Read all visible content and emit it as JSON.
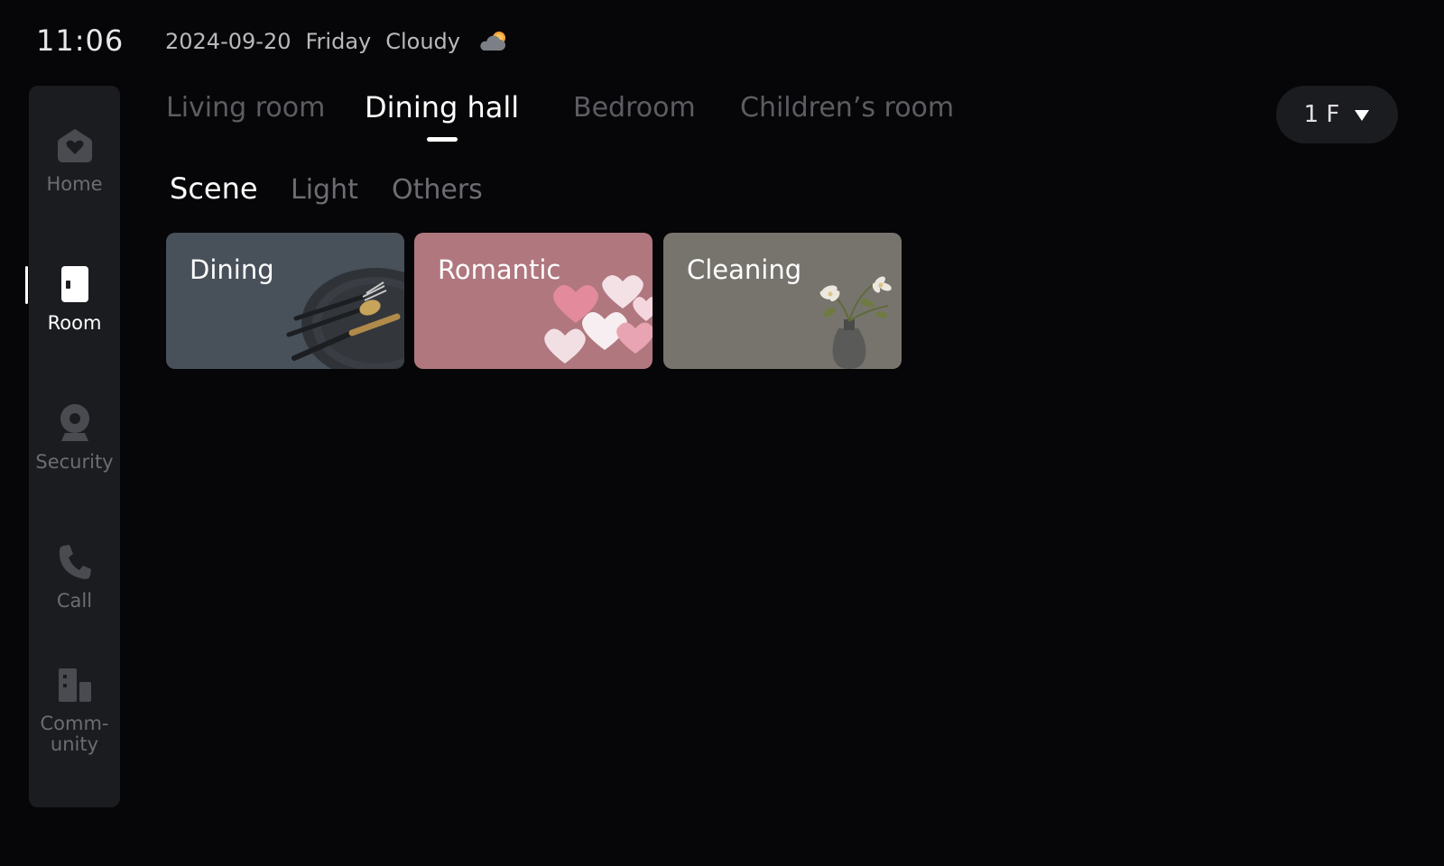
{
  "header": {
    "time": "11:06",
    "date": "2024-09-20",
    "weekday": "Friday",
    "weather": "Cloudy",
    "weather_icon": "cloud-sun-icon"
  },
  "sidebar": {
    "items": [
      {
        "label": "Home",
        "icon": "home-heart-icon",
        "active": false
      },
      {
        "label": "Room",
        "icon": "door-icon",
        "active": true
      },
      {
        "label": "Security",
        "icon": "camera-icon",
        "active": false
      },
      {
        "label": "Call",
        "icon": "phone-icon",
        "active": false
      },
      {
        "label": "Comm-\nunity",
        "icon": "building-icon",
        "active": false
      }
    ]
  },
  "rooms": {
    "tabs": [
      {
        "label": "Living room",
        "active": false
      },
      {
        "label": "Dining hall",
        "active": true
      },
      {
        "label": "Bedroom",
        "active": false
      },
      {
        "label": "Children’s room",
        "active": false
      }
    ],
    "floor": "1 F"
  },
  "categories": {
    "tabs": [
      {
        "label": "Scene",
        "active": true
      },
      {
        "label": "Light",
        "active": false
      },
      {
        "label": "Others",
        "active": false
      }
    ]
  },
  "scenes": [
    {
      "label": "Dining",
      "color": "#485059",
      "art": "plate-cutlery"
    },
    {
      "label": "Romantic",
      "color": "#b0777f",
      "art": "heart-balloons"
    },
    {
      "label": "Cleaning",
      "color": "#77746e",
      "art": "flower-vase"
    }
  ]
}
